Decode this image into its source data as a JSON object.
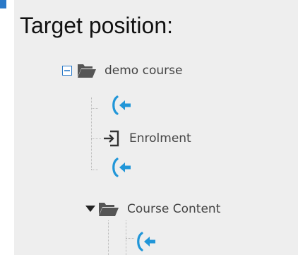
{
  "heading": "Target position:",
  "tree": {
    "root_label": "demo course",
    "enrolment_label": "Enrolment",
    "section_label": "Course Content"
  },
  "icons": {
    "collapse": "minus-box-icon",
    "folder_open": "folder-open-icon",
    "move_target": "move-here-arrow-icon",
    "enrol": "login-box-icon",
    "caret": "caret-down-icon"
  },
  "colors": {
    "panel_bg": "#eeeeee",
    "accent_blue": "#2a79c8",
    "move_target_blue": "#2196d8",
    "folder_gray": "#555555",
    "tree_text": "#444444"
  }
}
